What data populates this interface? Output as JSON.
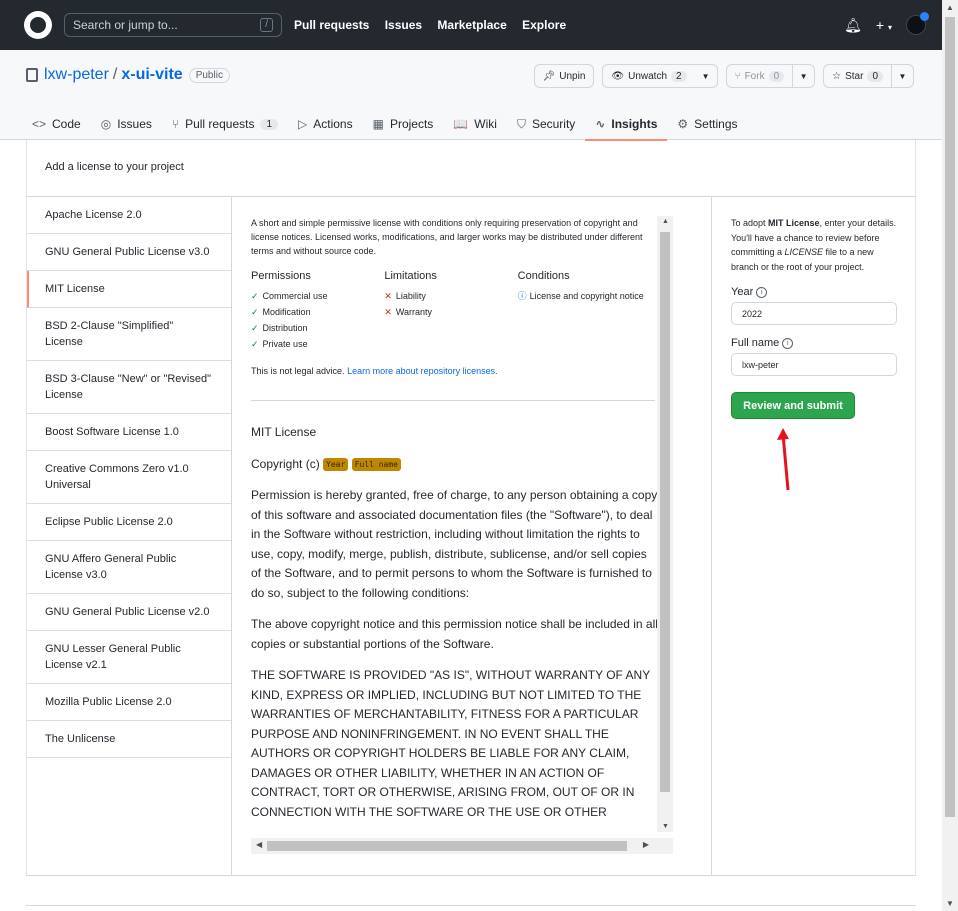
{
  "header": {
    "search_placeholder": "Search or jump to...",
    "slash_key": "/",
    "nav": [
      "Pull requests",
      "Issues",
      "Marketplace",
      "Explore"
    ],
    "plus_label": "+"
  },
  "repo": {
    "owner": "lxw-peter",
    "name": "x-ui-vite",
    "visibility": "Public",
    "unpin": "Unpin",
    "unwatch": "Unwatch",
    "watch_count": "2",
    "fork": "Fork",
    "fork_count": "0",
    "star": "Star",
    "star_count": "0"
  },
  "tabs": [
    {
      "label": "Code",
      "icon": "<>"
    },
    {
      "label": "Issues",
      "icon": "◎"
    },
    {
      "label": "Pull requests",
      "icon": "⑂",
      "count": "1"
    },
    {
      "label": "Actions",
      "icon": "▷"
    },
    {
      "label": "Projects",
      "icon": "▦"
    },
    {
      "label": "Wiki",
      "icon": "📖"
    },
    {
      "label": "Security",
      "icon": "⛉"
    },
    {
      "label": "Insights",
      "icon": "∿"
    },
    {
      "label": "Settings",
      "icon": "⚙"
    }
  ],
  "page_title": "Add a license to your project",
  "licenses": [
    "Apache License 2.0",
    "GNU General Public License v3.0",
    "MIT License",
    "BSD 2-Clause \"Simplified\" License",
    "BSD 3-Clause \"New\" or \"Revised\" License",
    "Boost Software License 1.0",
    "Creative Commons Zero v1.0 Universal",
    "Eclipse Public License 2.0",
    "GNU Affero General Public License v3.0",
    "GNU General Public License v2.0",
    "GNU Lesser General Public License v2.1",
    "Mozilla Public License 2.0",
    "The Unlicense"
  ],
  "selected_license_index": 2,
  "summary": "A short and simple permissive license with conditions only requiring preservation of copyright and license notices. Licensed works, modifications, and larger works may be distributed under different terms and without source code.",
  "permissions": {
    "title": "Permissions",
    "items": [
      "Commercial use",
      "Modification",
      "Distribution",
      "Private use"
    ]
  },
  "limitations": {
    "title": "Limitations",
    "items": [
      "Liability",
      "Warranty"
    ]
  },
  "conditions": {
    "title": "Conditions",
    "items": [
      "License and copyright notice"
    ]
  },
  "legal_text": "This is not legal advice.",
  "legal_link": "Learn more about repository licenses.",
  "license_text": {
    "title": "MIT License",
    "copyright_prefix": "Copyright (c)",
    "year_pill": "Year",
    "name_pill": "Full name",
    "p1": "Permission is hereby granted, free of charge, to any person obtaining a copy of this software and associated documentation files (the \"Software\"), to deal in the Software without restriction, including without limitation the rights to use, copy, modify, merge, publish, distribute, sublicense, and/or sell copies of the Software, and to permit persons to whom the Software is furnished to do so, subject to the following conditions:",
    "p2": "The above copyright notice and this permission notice shall be included in all copies or substantial portions of the Software.",
    "p3": "THE SOFTWARE IS PROVIDED \"AS IS\", WITHOUT WARRANTY OF ANY KIND, EXPRESS OR IMPLIED, INCLUDING BUT NOT LIMITED TO THE WARRANTIES OF MERCHANTABILITY, FITNESS FOR A PARTICULAR PURPOSE AND NONINFRINGEMENT. IN NO EVENT SHALL THE AUTHORS OR COPYRIGHT HOLDERS BE LIABLE FOR ANY CLAIM, DAMAGES OR OTHER LIABILITY, WHETHER IN AN ACTION OF CONTRACT, TORT OR OTHERWISE, ARISING FROM, OUT OF OR IN CONNECTION WITH THE SOFTWARE OR THE USE OR OTHER"
  },
  "sidebar": {
    "note_1": "To adopt ",
    "note_bold": "MIT License",
    "note_2": ", enter your details. You'll have a chance to review before committing a ",
    "note_italic": "LICENSE",
    "note_3": " file to a new branch or the root of your project.",
    "year_label": "Year",
    "year_value": "2022",
    "name_label": "Full name",
    "name_value": "lxw-peter",
    "submit": "Review and submit"
  },
  "colors": {
    "accent_orange": "#fd8c73",
    "submit_green": "#2da44e",
    "arrow_red": "#e3141e",
    "pill_gold": "#bf8700"
  }
}
